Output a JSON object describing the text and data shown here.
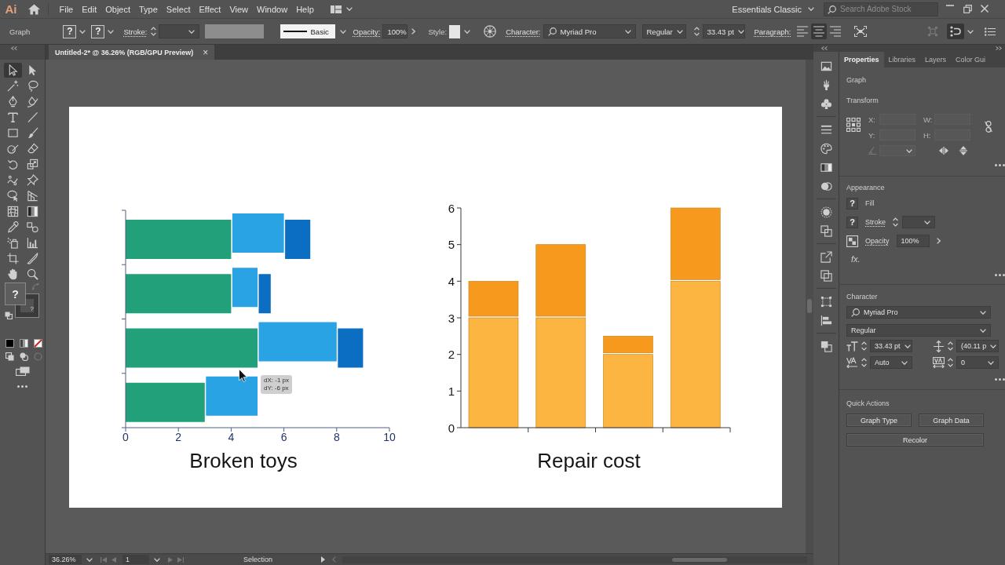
{
  "menu_bar": {
    "logo": "Ai",
    "menus": [
      "File",
      "Edit",
      "Object",
      "Type",
      "Select",
      "Effect",
      "View",
      "Window",
      "Help"
    ],
    "workspace": "Essentials Classic",
    "search": {
      "placeholder": "Search Adobe Stock"
    }
  },
  "control_bar": {
    "selection": "Graph",
    "fill_swatch": "?",
    "stroke_swatch": "?",
    "stroke_label": "Stroke:",
    "brush": "Basic",
    "opacity_label": "Opacity:",
    "opacity": "100%",
    "style_label": "Style:",
    "character_label": "Character:",
    "font": "Myriad Pro",
    "font_style": "Regular",
    "font_size": "33.43 pt",
    "paragraph_label": "Paragraph:",
    "alignment": [
      {
        "selected": false
      },
      {
        "selected": true
      },
      {
        "selected": false
      }
    ],
    "toggle": {
      "on": true
    }
  },
  "toolbar": {
    "tools": [
      {
        "selected": true
      },
      {
        "selected": false
      },
      {
        "selected": false
      },
      {
        "selected": false
      },
      {
        "selected": false
      },
      {
        "selected": false
      },
      {
        "selected": false
      },
      {
        "selected": false
      },
      {
        "selected": false
      },
      {
        "selected": false
      },
      {
        "selected": false
      },
      {
        "selected": false
      },
      {
        "selected": false
      },
      {
        "selected": false
      },
      {
        "selected": false
      },
      {
        "selected": false
      },
      {
        "selected": false
      },
      {
        "selected": false
      },
      {
        "selected": false
      },
      {
        "selected": false
      },
      {
        "selected": false
      },
      {
        "selected": false
      },
      {
        "selected": false
      },
      {
        "selected": false
      },
      {
        "selected": false
      },
      {
        "selected": false
      },
      {
        "selected": false
      },
      {
        "selected": false
      }
    ],
    "fill": "?",
    "stroke": "?"
  },
  "document_tab": {
    "title": "Untitled-2* @ 36.26% (RGB/GPU Preview)",
    "close": "×"
  },
  "canvas": {
    "charts": [
      {
        "chart_data": {
          "type": "bar",
          "orientation": "horizontal",
          "stacked": true,
          "title": "Broken toys",
          "xlim": [
            0,
            10
          ],
          "xticks": [
            0,
            2,
            4,
            6,
            8,
            10
          ],
          "series": [
            {
              "color": "#22a07a",
              "values": [
                4,
                4,
                5,
                3
              ]
            },
            {
              "color": "#2aa3e4",
              "values": [
                2,
                1,
                3,
                2
              ]
            },
            {
              "color": "#0b6ec2",
              "values": [
                1,
                0.5,
                1,
                0
              ]
            }
          ]
        }
      },
      {
        "chart_data": {
          "type": "bar",
          "orientation": "vertical",
          "stacked": true,
          "title": "Repair cost",
          "ylim": [
            0,
            6
          ],
          "yticks": [
            0,
            1,
            2,
            3,
            4,
            5,
            6
          ],
          "series": [
            {
              "color": "#fbb540",
              "values": [
                3,
                3,
                2,
                4
              ]
            },
            {
              "color": "#f7991c",
              "values": [
                1,
                2,
                0.5,
                2
              ]
            }
          ]
        }
      }
    ],
    "readout": [
      "dX: -1 px",
      "dY: -6 px"
    ]
  },
  "status_bar": {
    "zoom": "36.26%",
    "artboard": "1",
    "tool": "Selection"
  },
  "properties_panel": {
    "tabs": [
      {
        "label": "Properties",
        "selected": true
      },
      {
        "label": "Libraries",
        "selected": false
      },
      {
        "label": "Layers",
        "selected": false
      },
      {
        "label": "Color Gui",
        "selected": false
      }
    ],
    "selection": "Graph",
    "transform": {
      "title": "Transform",
      "fields": [
        {
          "kind": "text",
          "label": "X:",
          "disabled": true
        },
        {
          "kind": "text",
          "label": "W:",
          "disabled": true
        },
        {
          "kind": "text",
          "label": "Y:",
          "disabled": true
        },
        {
          "kind": "text",
          "label": "H:",
          "disabled": true
        },
        {
          "kind": "angle",
          "disabled": true
        }
      ]
    },
    "appearance": {
      "title": "Appearance",
      "fill_swatch": "?",
      "fill_label": "Fill",
      "stroke_swatch": "?",
      "stroke_label": "Stroke",
      "opacity_label": "Opacity",
      "opacity": "100%",
      "effects": "fx."
    },
    "character": {
      "title": "Character",
      "font": "Myriad Pro",
      "font_style": "Regular",
      "font_size": "33.43 pt",
      "leading": "(40.11 p",
      "kerning": "Auto",
      "tracking": "0"
    },
    "quick_actions": {
      "title": "Quick Actions",
      "buttons": [
        "Graph Type",
        "Graph Data",
        "Recolor"
      ]
    }
  }
}
